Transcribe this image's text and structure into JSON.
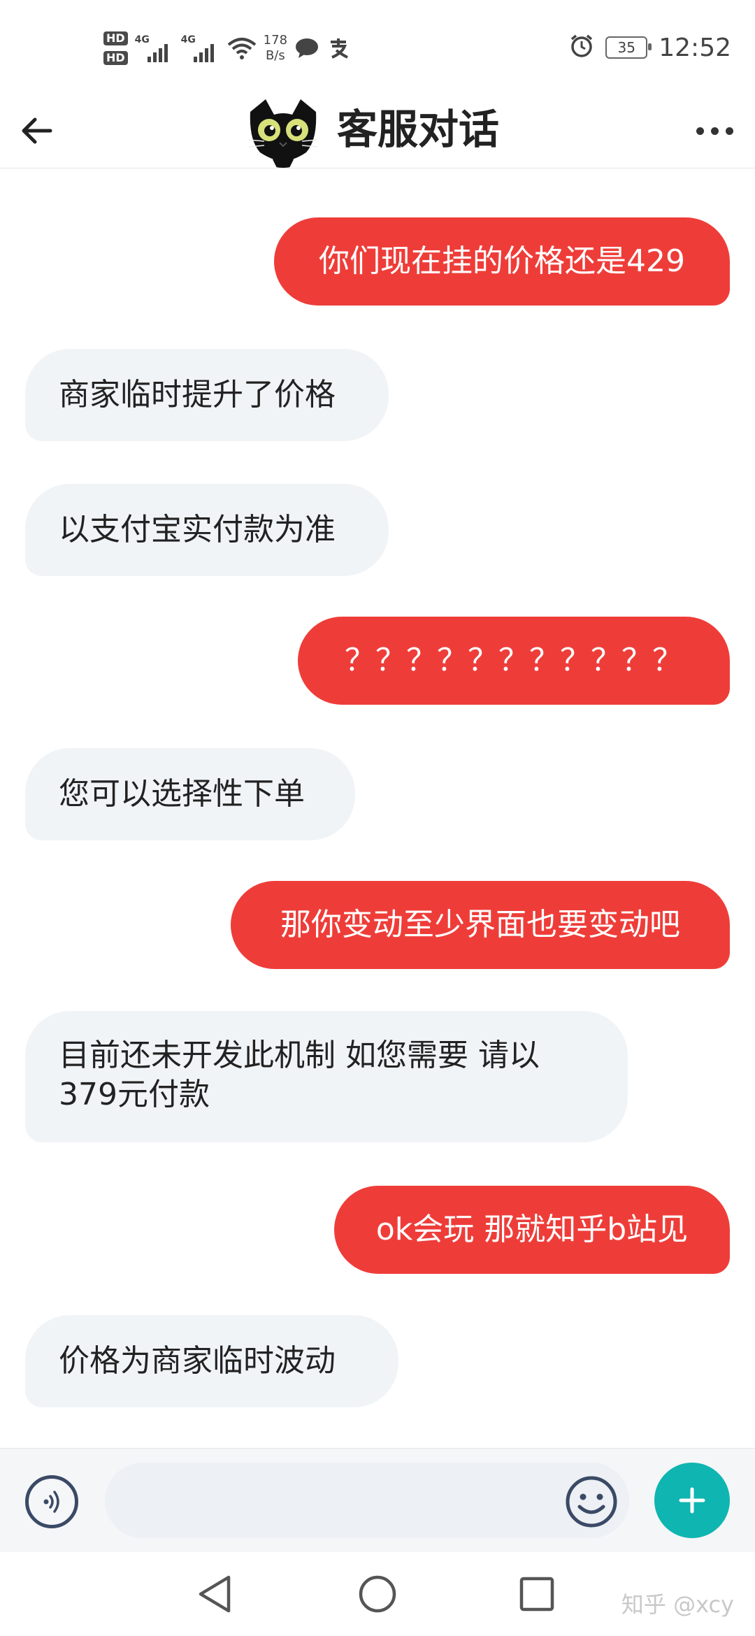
{
  "status_bar": {
    "hd_labels": [
      "HD",
      "HD"
    ],
    "network_labels": [
      "4G",
      "4G"
    ],
    "net_speed_value": "178",
    "net_speed_unit": "B/s",
    "battery_level": "35",
    "time": "12:52",
    "icons": [
      "signal-icon",
      "wifi-icon",
      "chat-icon",
      "alipay-icon",
      "alarm-icon",
      "battery-icon"
    ]
  },
  "header": {
    "title": "客服对话",
    "icons": [
      "back-arrow-icon",
      "more-icon"
    ]
  },
  "messages": [
    {
      "side": "me",
      "text": "你们现在挂的价格还是429"
    },
    {
      "side": "them",
      "text": "商家临时提升了价格"
    },
    {
      "side": "them",
      "text": "以支付宝实付款为准"
    },
    {
      "side": "me",
      "text": "？？？？？？？？？？？"
    },
    {
      "side": "them",
      "text": "您可以选择性下单"
    },
    {
      "side": "me",
      "text": "那你变动至少界面也要变动吧"
    },
    {
      "side": "them",
      "lines": [
        "目前还未开发此机制 如您需要 请以",
        "379元付款"
      ]
    },
    {
      "side": "me",
      "text": "ok会玩 那就知乎b站见"
    },
    {
      "side": "them",
      "text": "价格为商家临时波动"
    }
  ],
  "input_bar": {
    "placeholder": "",
    "icons": [
      "voice-icon",
      "emoji-icon",
      "plus-icon"
    ]
  },
  "nav_bar": {
    "icons": [
      "back-triangle-icon",
      "home-circle-icon",
      "recents-square-icon"
    ],
    "watermark": "知乎 @xcy"
  },
  "colors": {
    "my_bubble": "#ee3d39",
    "their_bubble": "#f1f4f7",
    "accent_teal": "#0fb5b0"
  }
}
